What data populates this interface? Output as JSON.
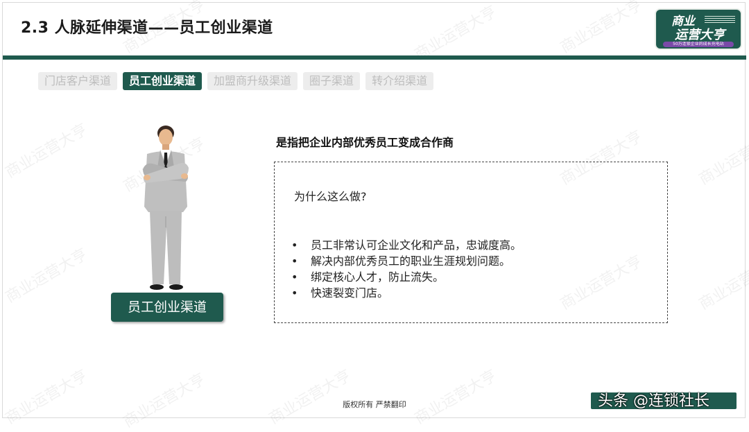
{
  "header": {
    "title": "2.3 人脉延伸渠道——员工创业渠道"
  },
  "logo": {
    "line1": "商业",
    "line2": "运营大亨",
    "tagline": "50万连锁企业的成长充电站"
  },
  "tabs": [
    {
      "label": "门店客户渠道",
      "active": false
    },
    {
      "label": "员工创业渠道",
      "active": true
    },
    {
      "label": "加盟商升级渠道",
      "active": false
    },
    {
      "label": "圈子渠道",
      "active": false
    },
    {
      "label": "转介绍渠道",
      "active": false
    }
  ],
  "figure": {
    "caption": "员工创业渠道"
  },
  "content": {
    "headline": "是指把企业内部优秀员工变成合作商",
    "question": "为什么这么做?",
    "bullet_symbol": "•",
    "bullets": [
      "员工非常认可企业文化和产品，忠诚度高。",
      "解决内部优秀员工的职业生涯规划问题。",
      "绑定核心人才，防止流失。",
      "快速裂变门店。"
    ]
  },
  "footer": {
    "copyright": "版权所有 严禁翻印",
    "source": "头条 @连锁社长"
  },
  "watermark": "商业运营大亨",
  "colors": {
    "brand": "#1f5a4e",
    "tab_inactive_bg": "#ededed",
    "tab_inactive_text": "#bdbdbd"
  }
}
